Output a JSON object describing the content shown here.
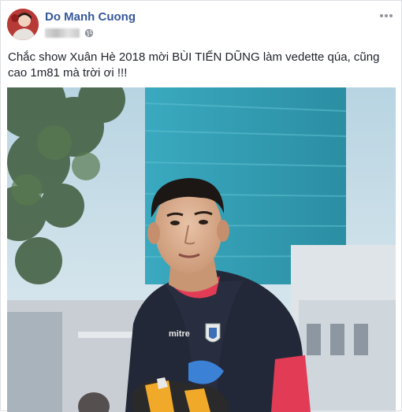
{
  "post": {
    "author": "Do Manh Cuong",
    "text": "Chắc show Xuân Hè 2018 mời BÙI TIẾN DŨNG làm vedette qúa, cũng cao 1m81 mà trời ơi !!!",
    "photo_brand_text": "mitre",
    "icons": {
      "privacy": "globe-icon",
      "more": "more-options-icon"
    }
  },
  "colors": {
    "author_link": "#365899",
    "text": "#1d2129",
    "sky": "#cfe3ee",
    "building": "#2f9fb4",
    "shirt": "#232838",
    "sleeve": "#e23b55"
  }
}
